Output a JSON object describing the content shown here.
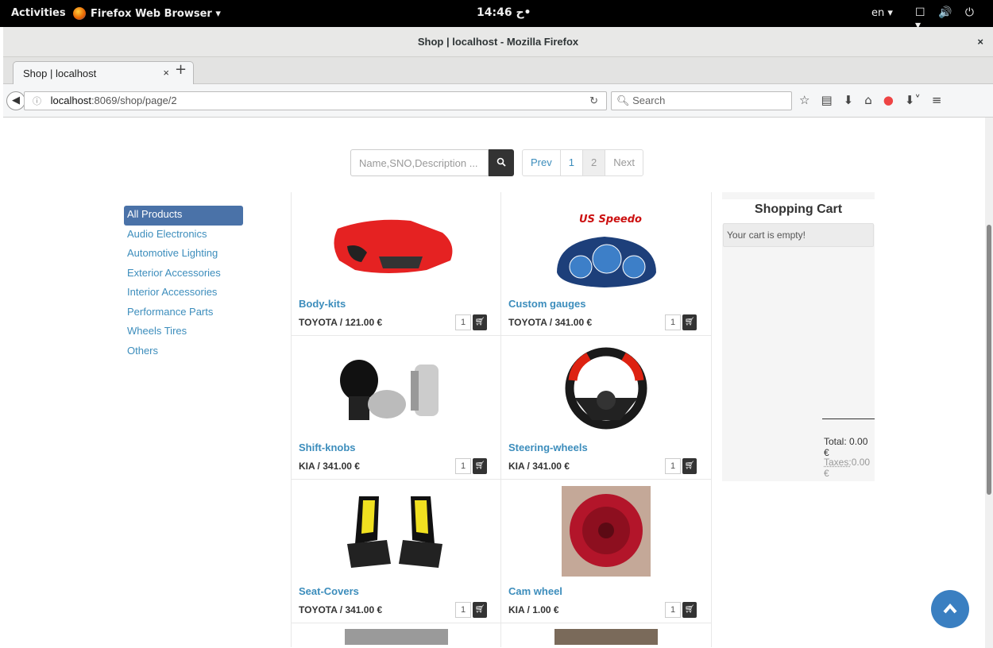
{
  "system": {
    "activities": "Activities",
    "app_name": "Firefox Web Browser ▾",
    "clock": "14:46 ح•",
    "lang": "en ▾",
    "tray": "☐ 🔊 ⏻ ▾"
  },
  "window": {
    "title": "Shop | localhost - Mozilla Firefox",
    "close": "×"
  },
  "tab": {
    "label": "Shop | localhost",
    "close": "×",
    "new": "+"
  },
  "nav": {
    "url_host": "localhost",
    "url_rest": ":8069/shop/page/2",
    "search_placeholder": "Search"
  },
  "shop": {
    "search_placeholder": "Name,SNO,Description ...",
    "pager": [
      "Prev",
      "1",
      "2",
      "Next"
    ],
    "categories": [
      "All Products",
      "Audio Electronics",
      "Automotive Lighting",
      "Exterior Accessories",
      "Interior Accessories",
      "Performance Parts",
      "Wheels Tires",
      "Others"
    ],
    "products": [
      {
        "name": "Body-kits",
        "price": "TOYOTA / 121.00 €",
        "qty": "1"
      },
      {
        "name": "Custom gauges",
        "price": "TOYOTA / 341.00 €",
        "qty": "1"
      },
      {
        "name": "Shift-knobs",
        "price": "KIA / 341.00 €",
        "qty": "1"
      },
      {
        "name": "Steering-wheels",
        "price": "KIA / 341.00 €",
        "qty": "1"
      },
      {
        "name": "Seat-Covers",
        "price": "TOYOTA / 341.00 €",
        "qty": "1"
      },
      {
        "name": "Cam wheel",
        "price": "KIA / 1.00 €",
        "qty": "1"
      }
    ],
    "gauge_logo": "US Speedo"
  },
  "cart": {
    "title": "Shopping Cart",
    "empty": "Your cart is empty!",
    "total": "Total: 0.00 €",
    "taxes_label": "Taxes:",
    "taxes_value": "0.00 €"
  }
}
